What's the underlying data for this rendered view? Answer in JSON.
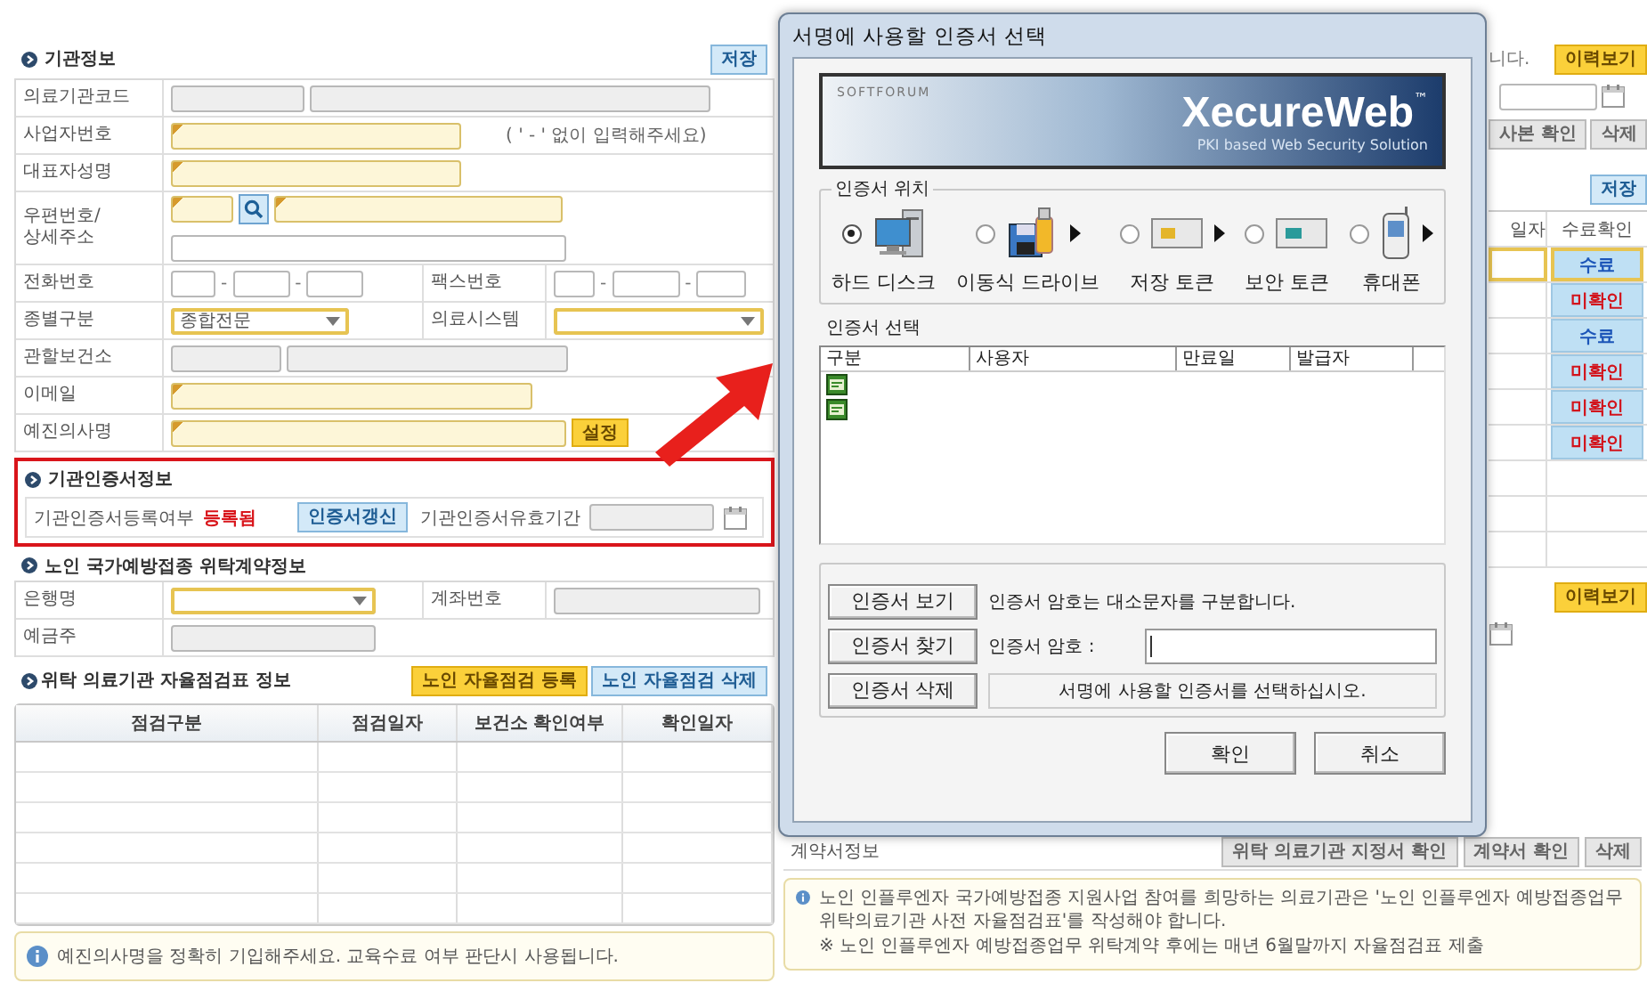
{
  "org_info": {
    "title": "기관정보",
    "save_button": "저장",
    "rows": [
      {
        "cells": [
          {
            "kind": "label",
            "text": "의료기관코드"
          },
          {
            "kind": "value",
            "parts": [
              {
                "kind": "readonly"
              },
              {
                "kind": "readonly"
              }
            ]
          }
        ]
      },
      {
        "cells": [
          {
            "kind": "label",
            "text": "사업자번호"
          },
          {
            "kind": "value",
            "parts": [
              {
                "kind": "required"
              },
              {
                "kind": "hint",
                "text": "( ' - ' 없이 입력해주세요)"
              }
            ]
          }
        ]
      },
      {
        "cells": [
          {
            "kind": "label",
            "text": "대표자성명"
          },
          {
            "kind": "value",
            "parts": [
              {
                "kind": "required"
              }
            ]
          }
        ]
      },
      {
        "cells": [
          {
            "kind": "label",
            "text": "우편번호/\n상세주소"
          },
          {
            "kind": "value",
            "parts": [
              {
                "kind": "required"
              },
              {
                "kind": "search"
              },
              {
                "kind": "required"
              },
              {
                "kind": "break"
              },
              {
                "kind": "plain"
              }
            ]
          }
        ]
      },
      {
        "cells": [
          {
            "kind": "label",
            "text": "전화번호"
          },
          {
            "kind": "value",
            "parts": [
              {
                "kind": "plain"
              },
              {
                "kind": "separator",
                "text": "-"
              },
              {
                "kind": "plain"
              },
              {
                "kind": "separator",
                "text": "-"
              },
              {
                "kind": "plain"
              }
            ]
          },
          {
            "kind": "label",
            "text": "팩스번호"
          },
          {
            "kind": "value",
            "parts": [
              {
                "kind": "plain"
              },
              {
                "kind": "separator",
                "text": "-"
              },
              {
                "kind": "plain"
              },
              {
                "kind": "separator",
                "text": "-"
              },
              {
                "kind": "plain"
              }
            ]
          }
        ]
      },
      {
        "cells": [
          {
            "kind": "label",
            "text": "종별구분"
          },
          {
            "kind": "value",
            "parts": [
              {
                "kind": "select",
                "value": "종합전문"
              }
            ]
          },
          {
            "kind": "label",
            "text": "의료시스템"
          },
          {
            "kind": "value",
            "parts": [
              {
                "kind": "select"
              }
            ]
          }
        ]
      },
      {
        "cells": [
          {
            "kind": "label",
            "text": "관할보건소"
          },
          {
            "kind": "value",
            "parts": [
              {
                "kind": "readonly"
              },
              {
                "kind": "readonly"
              }
            ]
          }
        ]
      },
      {
        "cells": [
          {
            "kind": "label",
            "text": "이메일"
          },
          {
            "kind": "value",
            "parts": [
              {
                "kind": "required"
              }
            ]
          }
        ]
      },
      {
        "cells": [
          {
            "kind": "label",
            "text": "예진의사명"
          },
          {
            "kind": "value",
            "parts": [
              {
                "kind": "required"
              },
              {
                "kind": "button",
                "text": "설정"
              }
            ]
          }
        ]
      }
    ]
  },
  "cert_info": {
    "title": "기관인증서정보",
    "highlighted": true,
    "registration_label": "기관인증서등록여부",
    "registration_status": "등록됨",
    "renew_button": "인증서갱신",
    "validity_label": "기관인증서유효기간"
  },
  "contract_info": {
    "title": "노인 국가예방접종 위탁계약정보",
    "rows": [
      {
        "cells": [
          {
            "kind": "label",
            "text": "은행명"
          },
          {
            "kind": "value",
            "parts": [
              {
                "kind": "select"
              }
            ]
          },
          {
            "kind": "label",
            "text": "계좌번호"
          },
          {
            "kind": "value",
            "parts": [
              {
                "kind": "readonly"
              }
            ]
          }
        ]
      },
      {
        "cells": [
          {
            "kind": "label",
            "text": "예금주"
          },
          {
            "kind": "value",
            "parts": [
              {
                "kind": "readonly"
              }
            ]
          }
        ]
      }
    ]
  },
  "self_check": {
    "title": "위탁 의료기관 자율점검표 정보",
    "buttons": [
      {
        "label": "노인 자율점검 등록",
        "kind": "primary"
      },
      {
        "label": "노인 자율점검 삭제",
        "kind": "secondary"
      }
    ],
    "columns": [
      "점검구분",
      "점검일자",
      "보건소 확인여부",
      "확인일자"
    ]
  },
  "notice": {
    "text": "예진의사명을 정확히 기입해주세요. 교육수료 여부 판단시 사용됩니다."
  },
  "right_panel": {
    "cut_text": "니다.",
    "history_button": "이력보기",
    "copy_button": "사본 확인",
    "delete_button": "삭제",
    "save_button": "저장",
    "table": {
      "columns": [
        "일자",
        "수료확인"
      ],
      "rows": [
        {
          "status": "수료",
          "confirmed": true,
          "selected": true
        },
        {
          "status": "미확인",
          "confirmed": false,
          "selected": false
        },
        {
          "status": "수료",
          "confirmed": true,
          "selected": false
        },
        {
          "status": "미확인",
          "confirmed": false,
          "selected": false
        },
        {
          "status": "미확인",
          "confirmed": false,
          "selected": false
        },
        {
          "status": "미확인",
          "confirmed": false,
          "selected": false
        }
      ]
    },
    "history_button_2": "이력보기",
    "contract_label": "계약서정보",
    "contract_buttons": [
      "위탁 의료기관 지정서 확인",
      "계약서 확인",
      "삭제"
    ],
    "notice_lines": [
      "노인 인플루엔자 국가예방접종 지원사업 참여를 희망하는 의료기관은 '노인 인플루엔자 예방접종업무 위탁의료기관 사전 자율점검표'를 작성해야 합니다.",
      "※ 노인 인플루엔자 예방접종업무 위탁계약 후에는 매년 6월말까지 자율점검표 제출"
    ]
  },
  "dialog": {
    "title": "서명에 사용할 인증서 선택",
    "banner": {
      "vendor": "SOFTFORUM",
      "product": "XecureWeb",
      "trademark": "™",
      "tagline": "PKI based Web Security Solution"
    },
    "location_group": {
      "title": "인증서 위치",
      "options": [
        {
          "label": "하드 디스크",
          "kind": "hard-disk",
          "selected": true,
          "has_menu": false
        },
        {
          "label": "이동식 드라이브",
          "kind": "removable",
          "selected": false,
          "has_menu": true
        },
        {
          "label": "저장 토큰",
          "kind": "storage-token",
          "selected": false,
          "has_menu": true
        },
        {
          "label": "보안 토큰",
          "kind": "security-token",
          "selected": false,
          "has_menu": false
        },
        {
          "label": "휴대폰",
          "kind": "phone",
          "selected": false,
          "has_menu": true
        }
      ]
    },
    "cert_list": {
      "title": "인증서 선택",
      "columns": [
        "구분",
        "사용자",
        "만료일",
        "발급자"
      ],
      "rows": [
        {
          "kind": "certificate"
        },
        {
          "kind": "certificate"
        }
      ]
    },
    "buttons": {
      "view": "인증서 보기",
      "find": "인증서 찾기",
      "delete": "인증서 삭제"
    },
    "case_note": "인증서 암호는 대소문자를 구분합니다.",
    "password_label": "인증서 암호 :",
    "status_message": "서명에 사용할 인증서를 선택하십시오.",
    "ok": "확인",
    "cancel": "취소"
  }
}
